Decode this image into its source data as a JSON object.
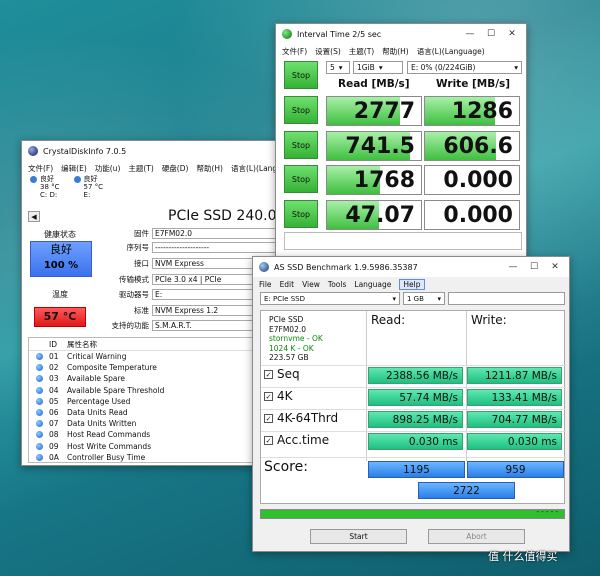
{
  "cdi": {
    "title": "CrystalDiskInfo 7.0.5",
    "menu": [
      "文件(F)",
      "编辑(E)",
      "功能(u)",
      "主题(T)",
      "硬盘(D)",
      "帮助(H)",
      "语言(L)(Lang"
    ],
    "drives": [
      {
        "status": "良好",
        "temp": "38 °C",
        "letter": "C: D:"
      },
      {
        "status": "良好",
        "temp": "57 °C",
        "letter": "E:"
      }
    ],
    "nav_label": "◀",
    "model": "PCIe SSD 240.0",
    "health_label": "健康状态",
    "health_status": "良好",
    "health_pct": "100 %",
    "temp_label": "温度",
    "temp_value": "57 °C",
    "fields": [
      {
        "k": "固件",
        "v": "E7FM02.0"
      },
      {
        "k": "序列号",
        "v": "--------------------"
      },
      {
        "k": "接口",
        "v": "NVM Express"
      },
      {
        "k": "传输模式",
        "v": "PCIe 3.0 x4 | PCIe"
      },
      {
        "k": "驱动器号",
        "v": "E:"
      },
      {
        "k": "标准",
        "v": "NVM Express 1.2"
      },
      {
        "k": "支持的功能",
        "v": "S.M.A.R.T."
      }
    ],
    "attr_headers": {
      "id": "ID",
      "name": "属性名称"
    },
    "attrs": [
      {
        "id": "01",
        "name": "Critical Warning"
      },
      {
        "id": "02",
        "name": "Composite Temperature"
      },
      {
        "id": "03",
        "name": "Available Spare"
      },
      {
        "id": "04",
        "name": "Available Spare Threshold"
      },
      {
        "id": "05",
        "name": "Percentage Used"
      },
      {
        "id": "06",
        "name": "Data Units Read"
      },
      {
        "id": "07",
        "name": "Data Units Written"
      },
      {
        "id": "08",
        "name": "Host Read Commands"
      },
      {
        "id": "09",
        "name": "Host Write Commands"
      },
      {
        "id": "0A",
        "name": "Controller Busy Time"
      }
    ]
  },
  "iv": {
    "title": "Interval Time 2/5 sec",
    "menu": [
      "文件(F)",
      "设置(S)",
      "主题(T)",
      "帮助(H)",
      "语言(L)(Language)"
    ],
    "count": "5",
    "size": "1GiB",
    "drive": "E: 0% (0/224GiB)",
    "stop_label": "Stop",
    "read_header": "Read [MB/s]",
    "write_header": "Write [MB/s]",
    "rows": [
      {
        "read": "2777",
        "write": "1286",
        "read_fill": 0.78,
        "write_fill": 0.74
      },
      {
        "read": "741.5",
        "write": "606.6",
        "read_fill": 0.88,
        "write_fill": 0.76
      },
      {
        "read": "1768",
        "write": "0.000",
        "read_fill": 0.56,
        "write_fill": 0
      },
      {
        "read": "47.07",
        "write": "0.000",
        "read_fill": 0.55,
        "write_fill": 0
      }
    ]
  },
  "as": {
    "title": "AS SSD Benchmark 1.9.5986.35387",
    "menu": [
      "File",
      "Edit",
      "View",
      "Tools",
      "Language",
      "Help"
    ],
    "drive_select": "E: PCIe SSD",
    "size_select": "1 GB",
    "info": {
      "model": "PCIe SSD",
      "fw": "E7FM02.0",
      "driver": "stornvme - OK",
      "align": "1024 K - OK",
      "size": "223.57 GB"
    },
    "read_header": "Read:",
    "write_header": "Write:",
    "rows": [
      {
        "label": "Seq",
        "read": "2388.56 MB/s",
        "write": "1211.87 MB/s"
      },
      {
        "label": "4K",
        "read": "57.74 MB/s",
        "write": "133.41 MB/s"
      },
      {
        "label": "4K-64Thrd",
        "read": "898.25 MB/s",
        "write": "704.77 MB/s"
      },
      {
        "label": "Acc.time",
        "read": "0.030 ms",
        "write": "0.030 ms"
      }
    ],
    "score_label": "Score:",
    "score_read": "1195",
    "score_write": "959",
    "score_total": "2722",
    "progress": 1.0,
    "progress_text": "- - - - -",
    "start_label": "Start",
    "abort_label": "Abort"
  },
  "watermark": "值 什么值得买"
}
